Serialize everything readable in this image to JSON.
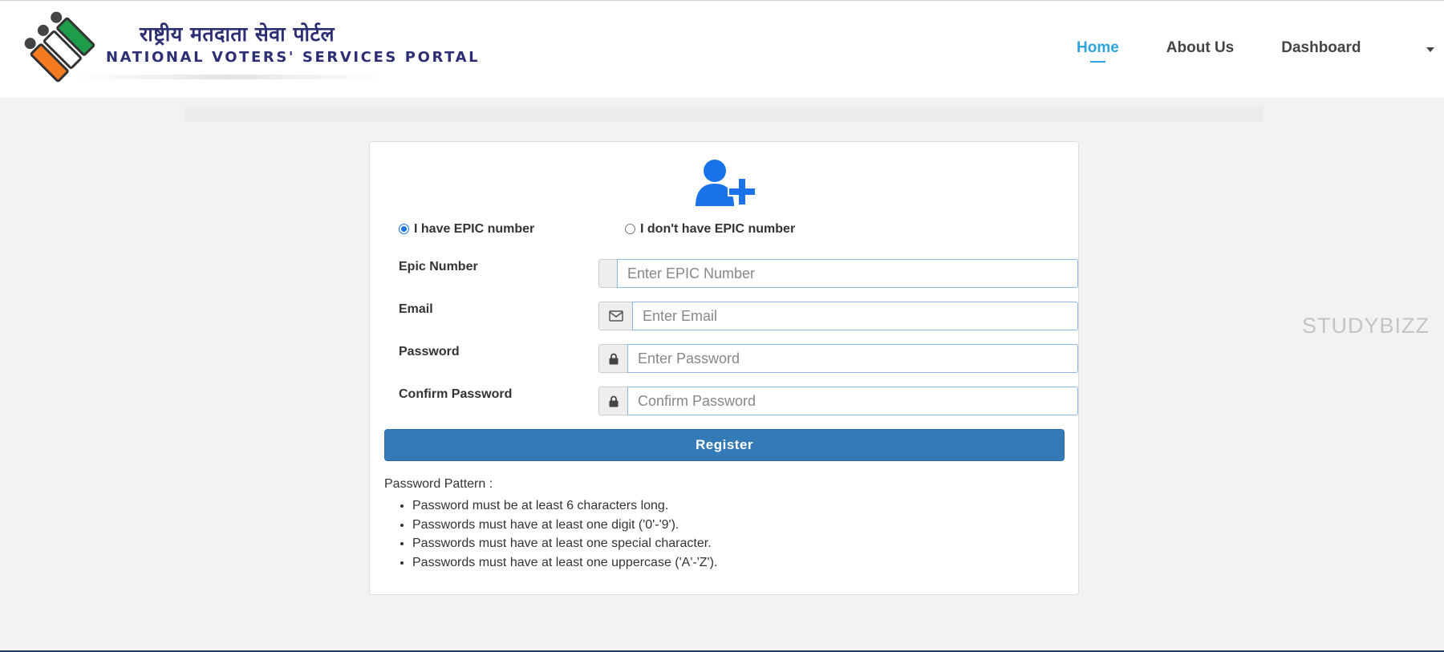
{
  "header": {
    "logo_hindi": "राष्ट्रीय मतदाता सेवा पोर्टल",
    "logo_english": "NATIONAL VOTERS' SERVICES PORTAL",
    "logo_colors": [
      "#f47b20",
      "#ffffff",
      "#1e9c4a"
    ],
    "nav": [
      {
        "label": "Home",
        "active": true
      },
      {
        "label": "About Us",
        "active": false
      },
      {
        "label": "Dashboard",
        "active": false
      }
    ],
    "nav_caret_icon": "caret-down-icon"
  },
  "form": {
    "icon": "user-plus-icon",
    "accent_color": "#1a73e8",
    "radio_options": [
      {
        "label": "I have EPIC number",
        "checked": true
      },
      {
        "label": "I don't have EPIC number",
        "checked": false
      }
    ],
    "fields": {
      "epic": {
        "label": "Epic Number",
        "placeholder": "Enter EPIC Number",
        "value": "",
        "icon": ""
      },
      "email": {
        "label": "Email",
        "placeholder": "Enter Email",
        "value": "",
        "icon": "envelope-icon"
      },
      "password": {
        "label": "Password",
        "placeholder": "Enter Password",
        "value": "",
        "icon": "lock-icon"
      },
      "confirm_password": {
        "label": "Confirm Password",
        "placeholder": "Confirm Password",
        "value": "",
        "icon": "lock-icon"
      }
    },
    "register_label": "Register",
    "register_color": "#337ab7",
    "password_pattern": {
      "title": "Password Pattern :",
      "rules": [
        "Password must be at least 6 characters long.",
        "Passwords must have at least one digit ('0'-'9').",
        "Passwords must have at least one special character.",
        "Passwords must have at least one uppercase ('A'-'Z')."
      ]
    }
  },
  "watermark": "STUDYBIZZ"
}
